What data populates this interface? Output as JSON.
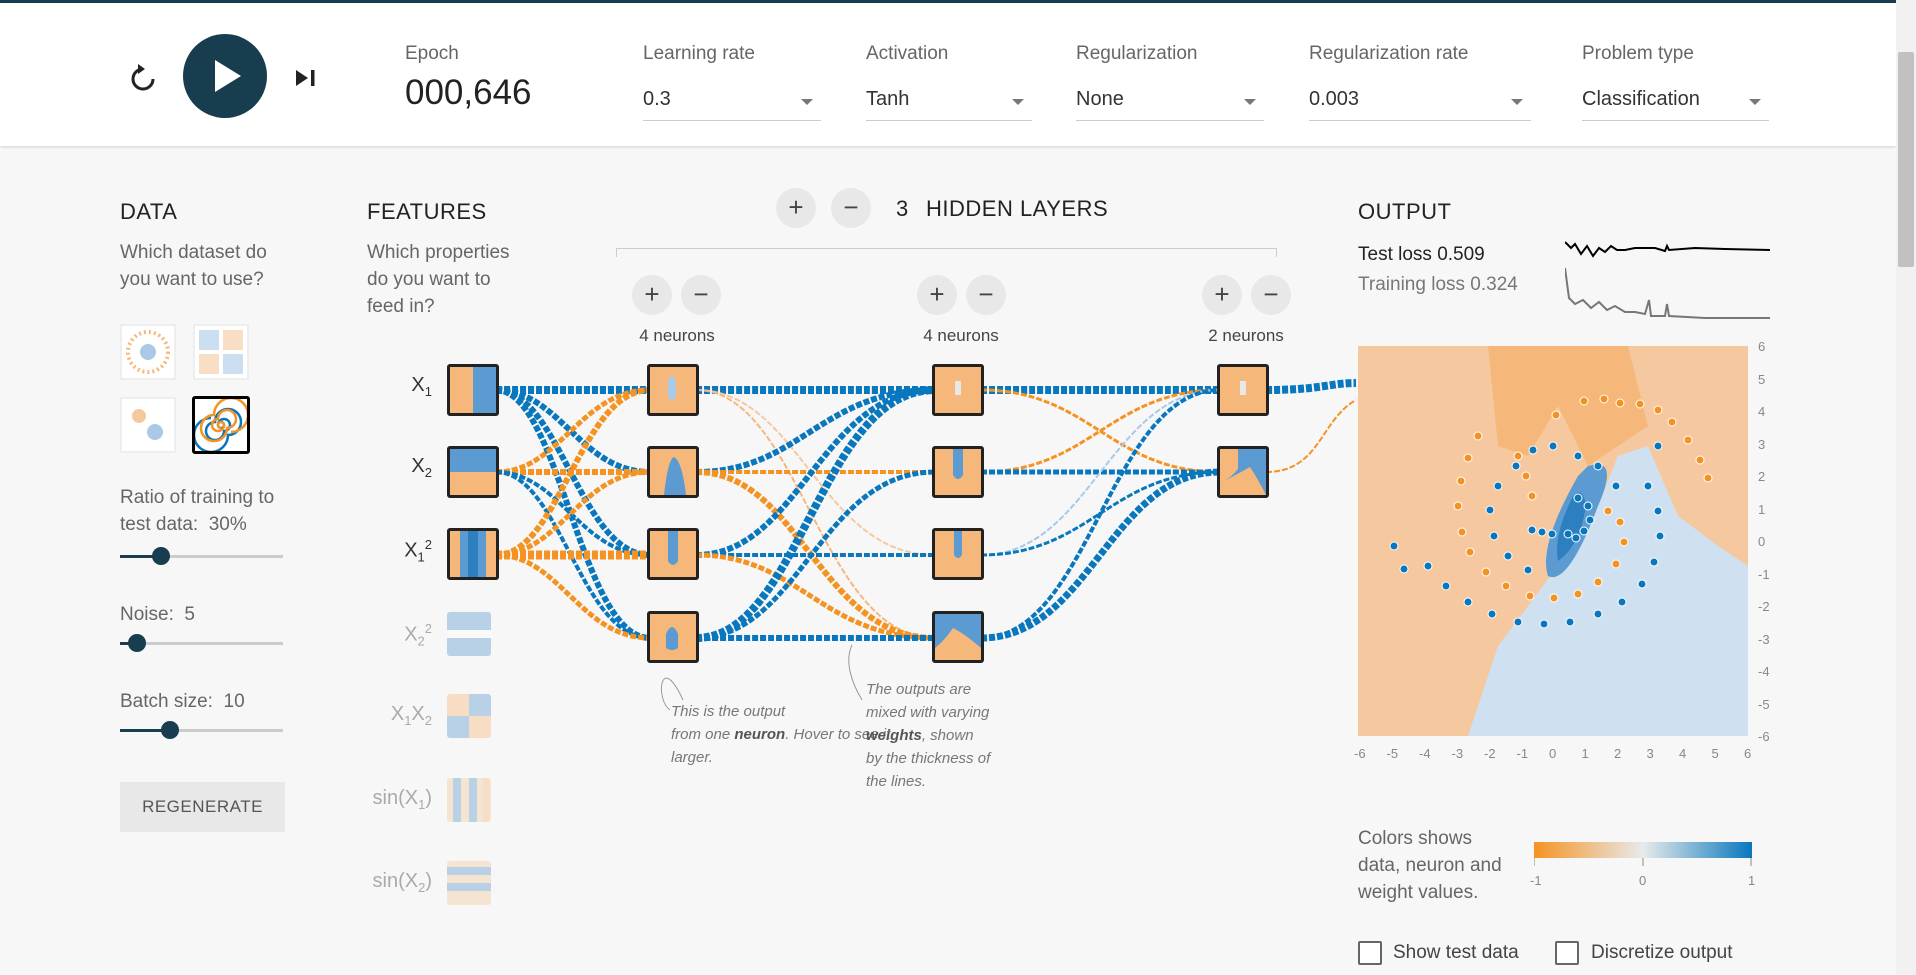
{
  "header": {
    "epoch_label": "Epoch",
    "epoch_value": "000,646",
    "controls": {
      "reset_icon": "reset-icon",
      "play_icon": "play-icon",
      "step_icon": "step-forward-icon"
    },
    "dropdowns": [
      {
        "label": "Learning rate",
        "value": "0.3"
      },
      {
        "label": "Activation",
        "value": "Tanh"
      },
      {
        "label": "Regularization",
        "value": "None"
      },
      {
        "label": "Regularization rate",
        "value": "0.003"
      },
      {
        "label": "Problem type",
        "value": "Classification"
      }
    ]
  },
  "data_panel": {
    "title": "DATA",
    "desc1": "Which dataset do",
    "desc2": "you want to use?",
    "datasets": [
      "circle",
      "xor",
      "gaussian",
      "spiral"
    ],
    "selected_dataset": "spiral",
    "ratio_label": "Ratio of training to",
    "ratio_label2": "test data:",
    "ratio_value": "30%",
    "noise_label": "Noise:",
    "noise_value": "5",
    "batch_label": "Batch size:",
    "batch_value": "10",
    "ratio_fraction": 0.3,
    "noise_fraction": 0.1,
    "batch_fraction": 0.3,
    "regenerate": "REGENERATE"
  },
  "features_panel": {
    "title": "FEATURES",
    "desc1": "Which properties",
    "desc2": "do you want to",
    "desc3": "feed in?",
    "features": [
      {
        "base": "X",
        "sub": "1",
        "sup": "",
        "active": true
      },
      {
        "base": "X",
        "sub": "2",
        "sup": "",
        "active": true
      },
      {
        "base": "X",
        "sub": "1",
        "sup": "2",
        "active": true
      },
      {
        "base": "X",
        "sub": "2",
        "sup": "2",
        "active": false
      },
      {
        "base": "X",
        "sub": "1",
        "mid": "X",
        "sub2": "2",
        "active": false
      },
      {
        "base": "sin(X",
        "sub": "1",
        "tail": ")",
        "active": false
      },
      {
        "base": "sin(X",
        "sub": "2",
        "tail": ")",
        "active": false
      }
    ]
  },
  "network": {
    "add": "+",
    "remove": "−",
    "layer_count": "3",
    "hidden_layers_label": "HIDDEN LAYERS",
    "layers": [
      {
        "neurons_label": "4 neurons"
      },
      {
        "neurons_label": "4 neurons"
      },
      {
        "neurons_label": "2 neurons"
      }
    ],
    "note1": [
      "This is the output",
      "from one ",
      "neuron",
      ". Hover to see it",
      "larger."
    ],
    "note2": [
      "The outputs are",
      "mixed with varying",
      "weights",
      ", shown",
      "by the thickness of",
      "the lines."
    ]
  },
  "output_panel": {
    "title": "OUTPUT",
    "test_loss": "Test loss 0.509",
    "training_loss": "Training loss 0.324",
    "y_ticks": [
      "6",
      "5",
      "4",
      "3",
      "2",
      "1",
      "0",
      "-1",
      "-2",
      "-3",
      "-4",
      "-5",
      "-6"
    ],
    "x_ticks": [
      "-6",
      "-5",
      "-4",
      "-3",
      "-2",
      "-1",
      "0",
      "1",
      "2",
      "3",
      "4",
      "5",
      "6"
    ],
    "legend_text": [
      "Colors shows",
      "data, neuron and",
      "weight values."
    ],
    "legend_ticks": [
      "-1",
      "0",
      "1"
    ],
    "show_test_data": "Show test data",
    "discretize_output": "Discretize output"
  },
  "colors": {
    "orange": "#f59322",
    "blue": "#0877bd",
    "dark": "#183d4e"
  }
}
